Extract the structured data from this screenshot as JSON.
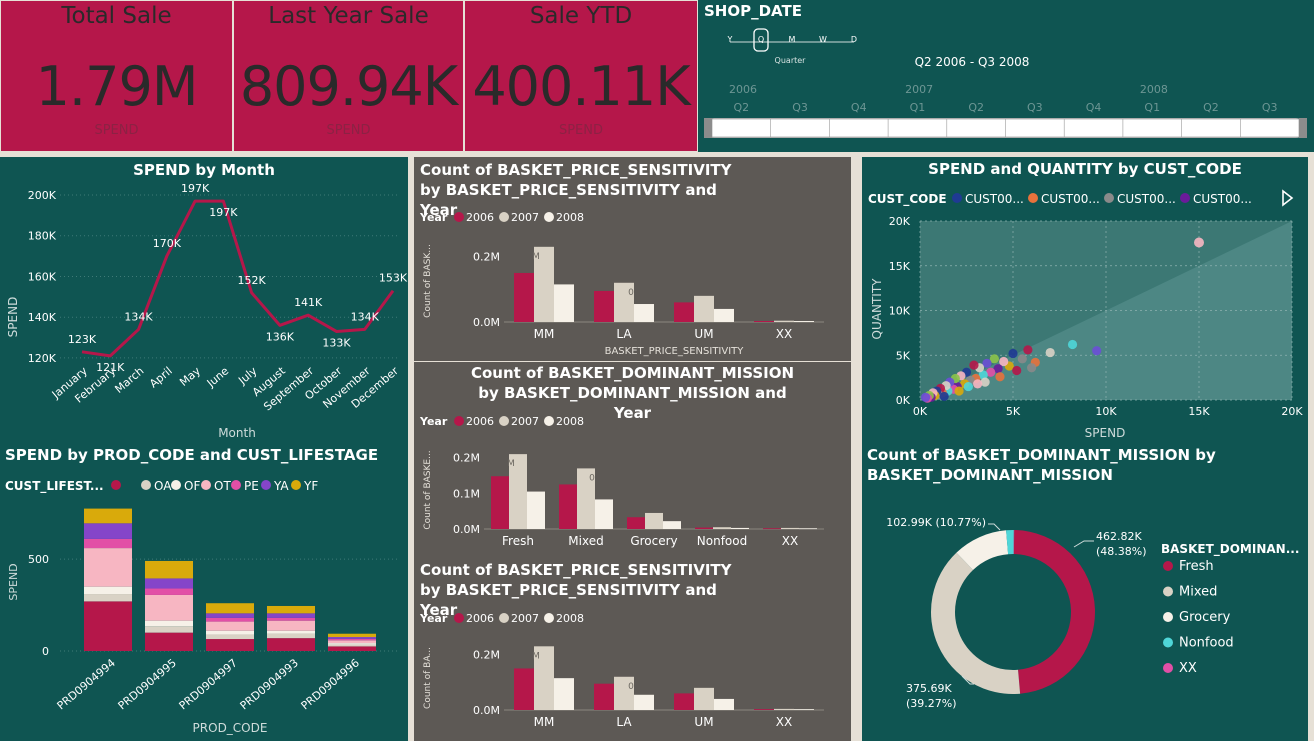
{
  "kpis": [
    {
      "title": "Total Sale",
      "value": "1.79M",
      "sub": "SPEND"
    },
    {
      "title": "Last Year Sale",
      "value": "809.94K",
      "sub": "SPEND"
    },
    {
      "title": "Sale YTD",
      "value": "400.11K",
      "sub": "SPEND"
    }
  ],
  "slicer": {
    "title": "SHOP_DATE",
    "levels": [
      "Y",
      "Q",
      "M",
      "W",
      "D"
    ],
    "level_label": "Quarter",
    "range_text": "Q2 2006 - Q3 2008",
    "years": [
      "2006",
      "2007",
      "2008"
    ],
    "quarters": [
      "Q2",
      "Q3",
      "Q4",
      "Q1",
      "Q2",
      "Q3",
      "Q4",
      "Q1",
      "Q2",
      "Q3"
    ]
  },
  "colors": {
    "teal": "#0f5552",
    "crimson": "#b5174a",
    "beige": "#d9d2c5",
    "cream": "#f6f1e8",
    "grey": "#5d5955"
  },
  "chart_data": [
    {
      "id": "spend_by_month",
      "type": "line",
      "title": "SPEND by Month",
      "xlabel": "Month",
      "ylabel": "SPEND",
      "categories": [
        "January",
        "February",
        "March",
        "April",
        "May",
        "June",
        "July",
        "August",
        "September",
        "October",
        "November",
        "December"
      ],
      "values": [
        123,
        121,
        134,
        170,
        197,
        197,
        152,
        136,
        141,
        133,
        134,
        153
      ],
      "labels": [
        "123K",
        "121K",
        "134K",
        "170K",
        "197K",
        "197K",
        "152K",
        "136K",
        "141K",
        "133K",
        "134K",
        "153K"
      ],
      "yticks": [
        "120K",
        "140K",
        "160K",
        "180K",
        "200K"
      ],
      "ylim": [
        118,
        200
      ],
      "color": "#b5174a"
    },
    {
      "id": "bps_top",
      "type": "bar",
      "title": "Count of BASKET_PRICE_SENSITIVITY by BASKET_PRICE_SENSITIVITY and Year",
      "legend_title": "Year",
      "xlabel": "BASKET_PRICE_SENSITIVITY",
      "ylabel": "Count of BASK...",
      "categories": [
        "MM",
        "LA",
        "UM",
        "XX"
      ],
      "series": [
        {
          "name": "2006",
          "values": [
            0.15,
            0.095,
            0.06,
            0.003
          ]
        },
        {
          "name": "2007",
          "values": [
            0.23,
            0.12,
            0.08,
            0.004
          ]
        },
        {
          "name": "2008",
          "values": [
            0.115,
            0.055,
            0.04,
            0.003
          ]
        }
      ],
      "yticks": [
        "0.0M",
        "0.2M"
      ],
      "ylim": [
        0,
        0.26
      ],
      "bar_labels": [
        "M",
        "0"
      ]
    },
    {
      "id": "bdm_center",
      "type": "bar",
      "title": "Count of BASKET_DOMINANT_MISSION by BASKET_DOMINANT_MISSION and Year",
      "legend_title": "Year",
      "xlabel": "",
      "ylabel": "Count of BASKE...",
      "categories": [
        "Fresh",
        "Mixed",
        "Grocery",
        "Nonfood",
        "XX"
      ],
      "series": [
        {
          "name": "2006",
          "values": [
            0.148,
            0.125,
            0.033,
            0.004,
            0.002
          ]
        },
        {
          "name": "2007",
          "values": [
            0.21,
            0.17,
            0.045,
            0.005,
            0.003
          ]
        },
        {
          "name": "2008",
          "values": [
            0.105,
            0.083,
            0.022,
            0.003,
            0.002
          ]
        }
      ],
      "yticks": [
        "0.0M",
        "0.1M",
        "0.2M"
      ],
      "ylim": [
        0,
        0.23
      ],
      "bar_labels": [
        "M",
        "0"
      ]
    },
    {
      "id": "bps_bottom",
      "type": "bar",
      "title": "Count of BASKET_PRICE_SENSITIVITY by BASKET_PRICE_SENSITIVITY and Year",
      "legend_title": "Year",
      "xlabel": "",
      "ylabel": "Count of BA...",
      "categories": [
        "MM",
        "LA",
        "UM",
        "XX"
      ],
      "series": [
        {
          "name": "2006",
          "values": [
            0.15,
            0.095,
            0.06,
            0.003
          ]
        },
        {
          "name": "2007",
          "values": [
            0.23,
            0.12,
            0.08,
            0.004
          ]
        },
        {
          "name": "2008",
          "values": [
            0.115,
            0.055,
            0.04,
            0.003
          ]
        }
      ],
      "yticks": [
        "0.0M",
        "0.2M"
      ],
      "ylim": [
        0,
        0.26
      ],
      "bar_labels": [
        "M",
        "0"
      ]
    },
    {
      "id": "spend_quantity",
      "type": "scatter",
      "title": "SPEND and QUANTITY by CUST_CODE",
      "legend_title": "CUST_CODE",
      "legend": [
        "CUST00...",
        "CUST00...",
        "CUST00...",
        "CUST00..."
      ],
      "legend_colors": [
        "#1f3a93",
        "#e8723c",
        "#8a8a8a",
        "#6a1b9a"
      ],
      "xlabel": "SPEND",
      "ylabel": "QUANTITY",
      "xticks": [
        "0K",
        "5K",
        "10K",
        "15K",
        "20K"
      ],
      "yticks": [
        "0K",
        "5K",
        "10K",
        "15K",
        "20K"
      ],
      "xlim": [
        0,
        20
      ],
      "ylim": [
        0,
        20
      ],
      "points": [
        [
          15,
          17.6
        ],
        [
          9.5,
          5.5
        ],
        [
          8.2,
          6.2
        ],
        [
          7,
          5.3
        ],
        [
          6.2,
          4.2
        ],
        [
          5.8,
          5.6
        ],
        [
          5.5,
          4.6
        ],
        [
          5,
          5.2
        ],
        [
          4.8,
          3.8
        ],
        [
          4.5,
          4.3
        ],
        [
          4.2,
          3.5
        ],
        [
          4,
          4.6
        ],
        [
          3.8,
          3.1
        ],
        [
          3.6,
          4.1
        ],
        [
          3.4,
          2.8
        ],
        [
          3.2,
          3.6
        ],
        [
          3,
          2.4
        ],
        [
          2.9,
          3.9
        ],
        [
          2.7,
          2.2
        ],
        [
          2.5,
          3.1
        ],
        [
          2.4,
          1.8
        ],
        [
          2.2,
          2.7
        ],
        [
          2,
          1.5
        ],
        [
          1.9,
          2.4
        ],
        [
          1.8,
          1.2
        ],
        [
          1.6,
          2
        ],
        [
          1.5,
          1
        ],
        [
          1.4,
          1.6
        ],
        [
          1.2,
          0.8
        ],
        [
          1.1,
          1.3
        ],
        [
          1,
          0.6
        ],
        [
          0.9,
          1
        ],
        [
          0.8,
          0.5
        ],
        [
          0.7,
          0.8
        ],
        [
          0.6,
          0.3
        ],
        [
          0.5,
          0.5
        ],
        [
          0.4,
          0.2
        ],
        [
          0.3,
          0.3
        ],
        [
          2.6,
          1.5
        ],
        [
          3.5,
          2
        ],
        [
          4.3,
          2.6
        ],
        [
          5.2,
          3.3
        ],
        [
          6,
          3.6
        ],
        [
          1.3,
          0.4
        ],
        [
          2.1,
          1
        ],
        [
          3.1,
          1.8
        ]
      ]
    },
    {
      "id": "spend_prod",
      "type": "bar",
      "title": "SPEND by PROD_CODE and CUST_LIFESTAGE",
      "legend_title": "CUST_LIFEST...",
      "legend": [
        "",
        "OA",
        "OF",
        "OT",
        "PE",
        "YA",
        "YF"
      ],
      "xlabel": "PROD_CODE",
      "ylabel": "SPEND",
      "categories": [
        "PRD0904994",
        "PRD0904995",
        "PRD0904997",
        "PRD0904993",
        "PRD0904996"
      ],
      "series": [
        {
          "name": "",
          "values": [
            270,
            100,
            65,
            70,
            25
          ]
        },
        {
          "name": "OA",
          "values": [
            40,
            35,
            25,
            25,
            10
          ]
        },
        {
          "name": "OF",
          "values": [
            40,
            30,
            20,
            15,
            8
          ]
        },
        {
          "name": "OT",
          "values": [
            210,
            140,
            50,
            55,
            15
          ]
        },
        {
          "name": "PE",
          "values": [
            50,
            35,
            20,
            15,
            8
          ]
        },
        {
          "name": "YA",
          "values": [
            85,
            55,
            25,
            25,
            10
          ]
        },
        {
          "name": "YF",
          "values": [
            80,
            95,
            55,
            40,
            18
          ]
        }
      ],
      "stack_colors": [
        "#b5174a",
        "#d9d2c5",
        "#f6f1e8",
        "#f7b6c2",
        "#e24fa6",
        "#8545c9",
        "#d9aa0b"
      ],
      "yticks": [
        "0",
        "500"
      ],
      "ylim": [
        0,
        800
      ]
    },
    {
      "id": "bdm_donut",
      "type": "pie",
      "title": "Count of BASKET_DOMINANT_MISSION by BASKET_DOMINANT_MISSION",
      "legend_title": "BASKET_DOMINAN...",
      "labels": [
        "Fresh",
        "Mixed",
        "Grocery",
        "Nonfood",
        "XX"
      ],
      "values": [
        48.38,
        39.27,
        10.77,
        1.5,
        0.08
      ],
      "colors": [
        "#b5174a",
        "#d9d2c5",
        "#f6f1e8",
        "#4fd6d8",
        "#e24fa6"
      ],
      "data_labels": [
        {
          "value": "462.82K",
          "pct": "(48.38%)"
        },
        {
          "value": "375.69K",
          "pct": "(39.27%)"
        },
        {
          "value": "102.99K (10.77%)"
        }
      ]
    }
  ]
}
